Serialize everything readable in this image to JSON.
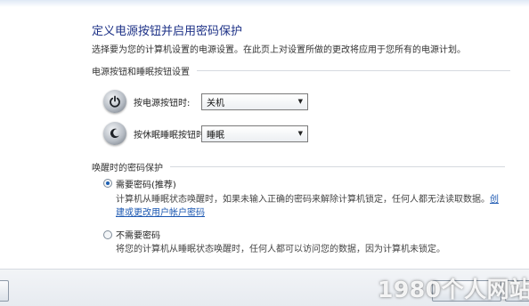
{
  "page": {
    "title": "定义电源按钮并启用密码保护",
    "description": "选择要为您的计算机设置的电源设置。在此页上对设置所做的更改将应用于您所有的电源计划。"
  },
  "power_section": {
    "header": "电源按钮和睡眠按钮设置",
    "power_button": {
      "label": "按电源按钮时:",
      "value": "关机"
    },
    "sleep_button": {
      "label": "按休眠睡眠按钮时:",
      "value": "睡眠"
    }
  },
  "password_section": {
    "header": "唤醒时的密码保护",
    "require_password": {
      "label": "需要密码(推荐)",
      "selected": true,
      "desc_line1": "计算机从睡眠状态唤醒时，如果未输入正确的密码来解除计算机锁定，任何人都无法读取数据。",
      "link_part1": "创",
      "link_part2": "建或更改用户帐户密码"
    },
    "no_password": {
      "label": "不需要密码",
      "selected": false,
      "desc": "将您的计算机从睡眠状态唤醒时，任何人都可以访问您的数据，因为计算机未锁定。"
    }
  },
  "watermark": "1980个人网站",
  "colors": {
    "title": "#1e3287",
    "link": "#1b57b1",
    "radio_selected": "#1c5fb3"
  }
}
